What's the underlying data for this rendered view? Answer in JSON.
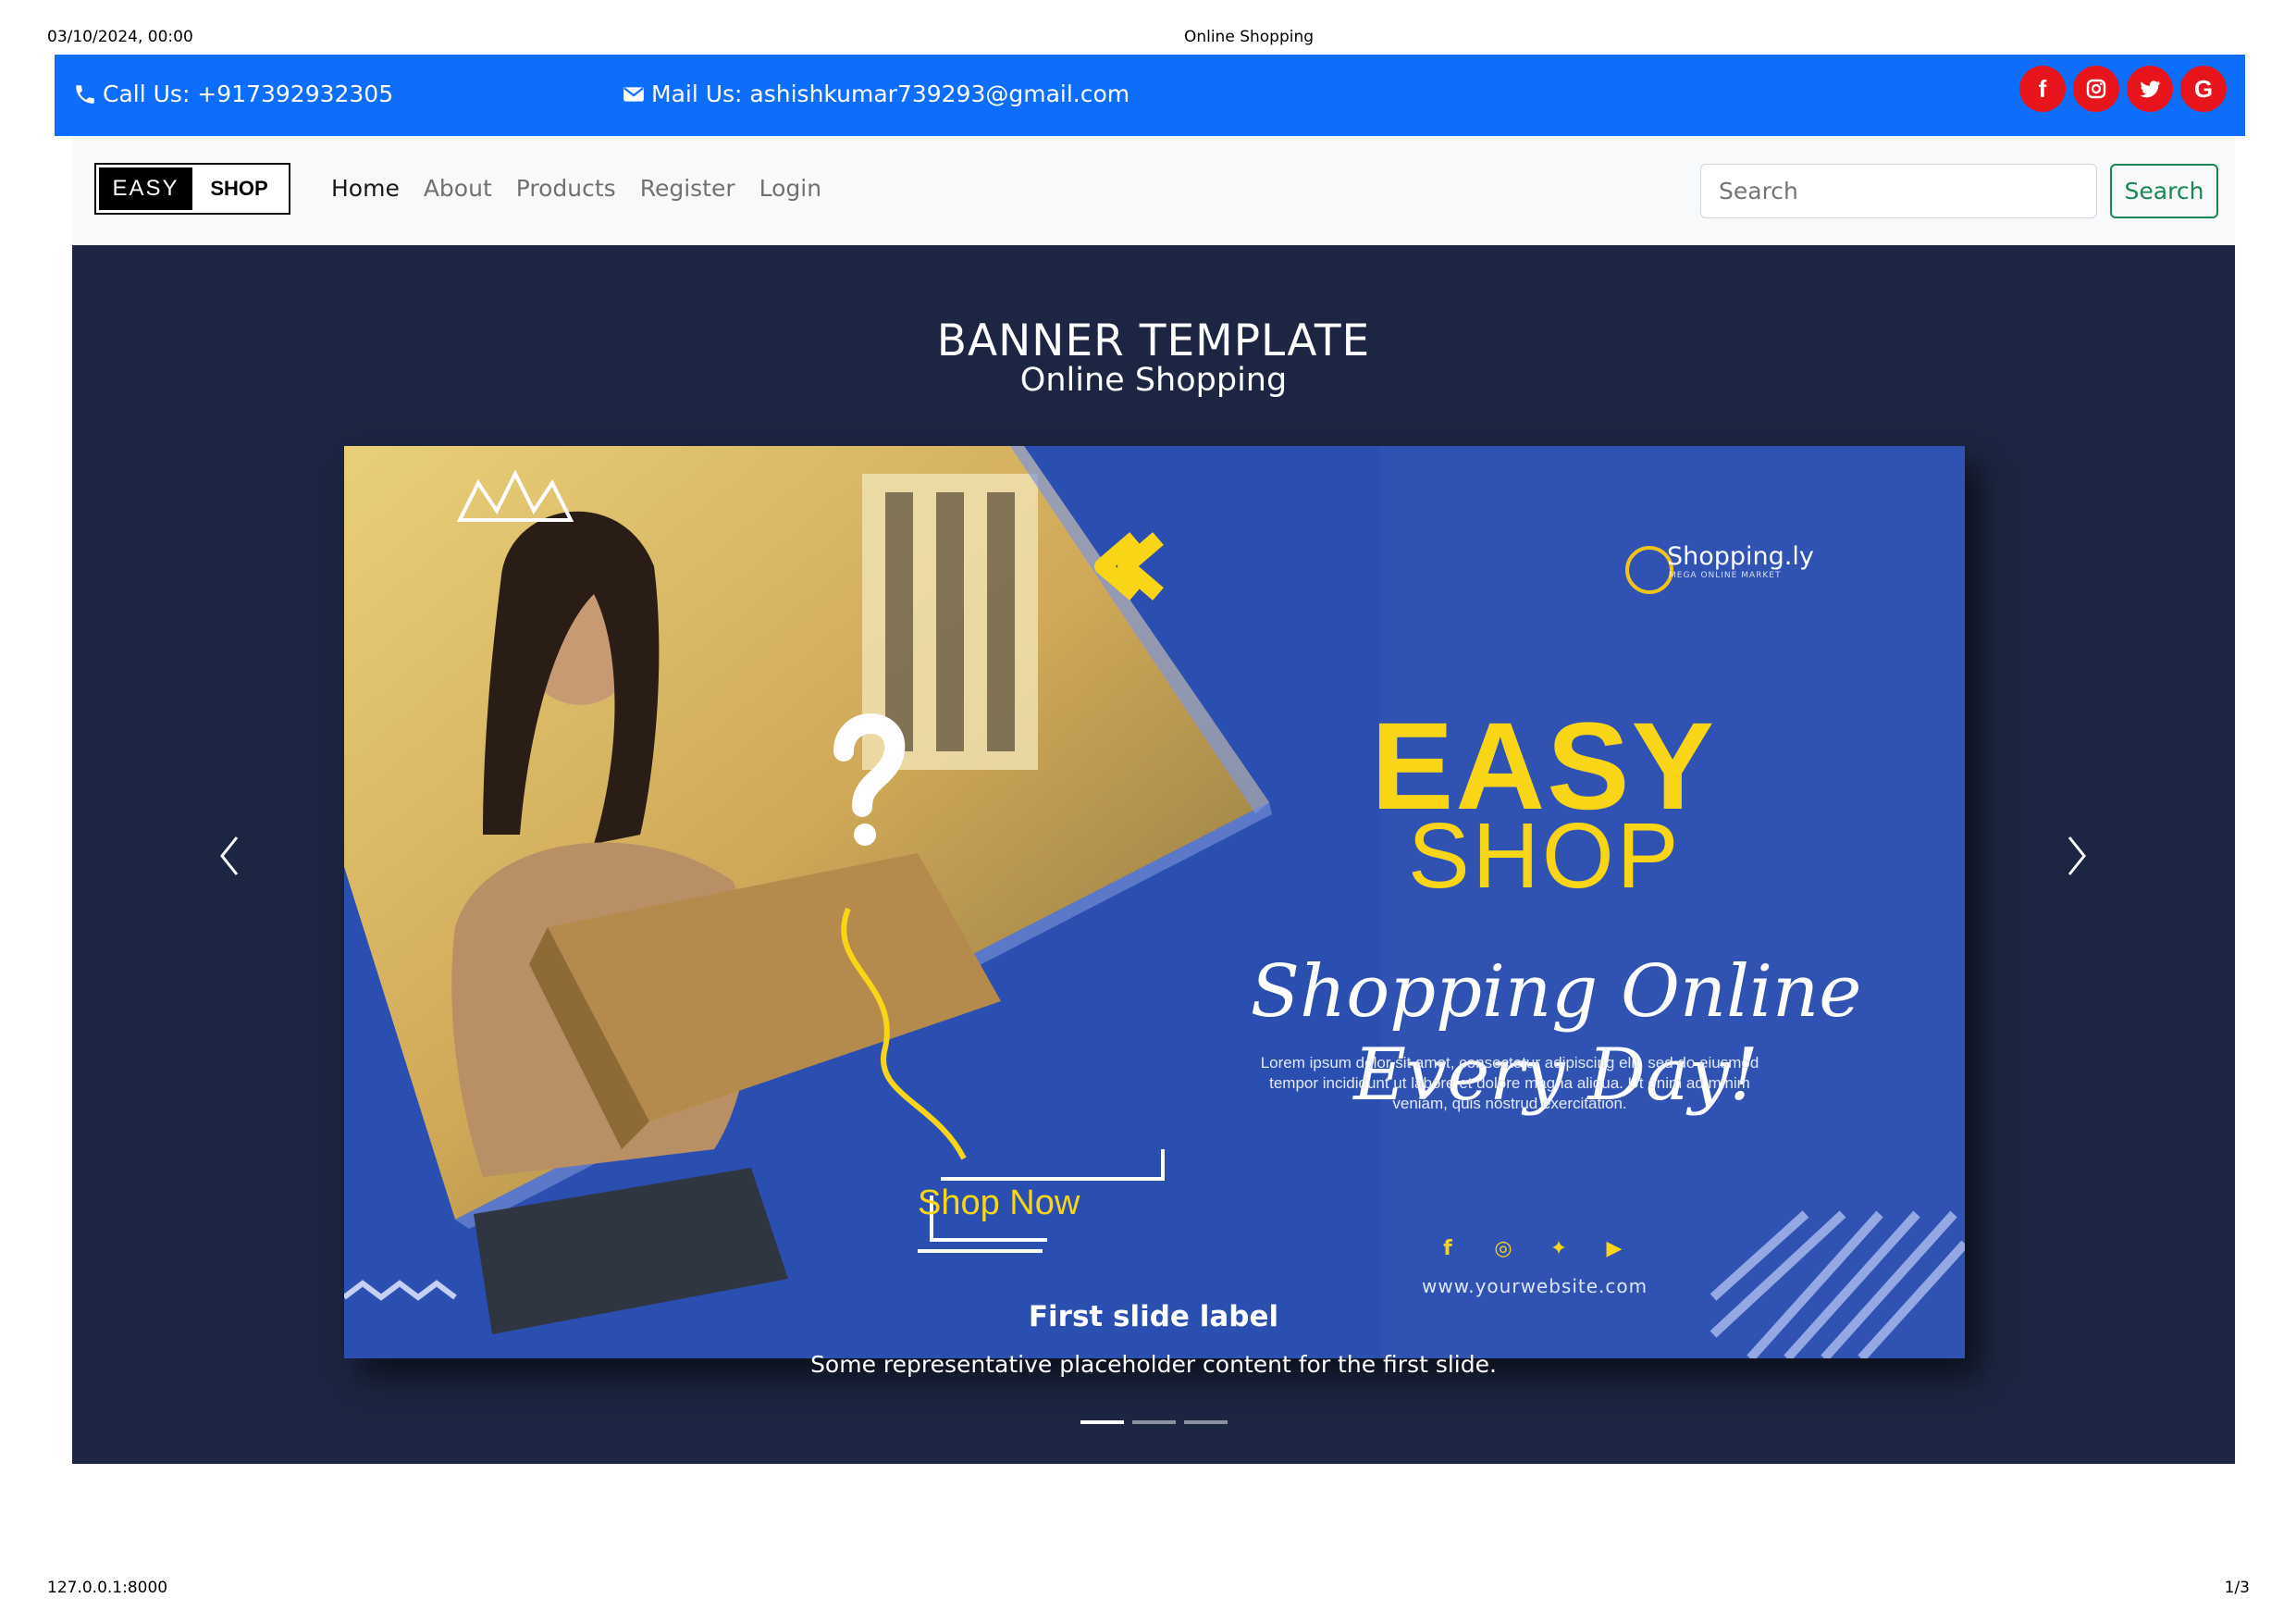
{
  "print": {
    "datetime": "03/10/2024, 00:00",
    "title": "Online Shopping",
    "url": "127.0.0.1:8000",
    "page": "1/3"
  },
  "topbar": {
    "phone": "Call Us: +917392932305",
    "mail": "Mail Us: ashishkumar739293@gmail.com",
    "socials": [
      "facebook-icon",
      "instagram-icon",
      "twitter-icon",
      "google-icon"
    ],
    "bg_color": "#0d6efd",
    "social_color": "#e8141b"
  },
  "navbar": {
    "logo_left": "EASY",
    "logo_right": "SHOP",
    "links": [
      "Home",
      "About",
      "Products",
      "Register",
      "Login"
    ],
    "search_placeholder": "Search",
    "search_button": "Search"
  },
  "carousel": {
    "banner_title": "BANNER TEMPLATE",
    "banner_subtitle": "Online Shopping",
    "card": {
      "brand": "Shopping.ly",
      "brand_sub": "MEGA ONLINE MARKET",
      "headline_1": "EASY",
      "headline_2": "SHOP",
      "tagline": "Shopping Online Every Day!",
      "lorem": "Lorem ipsum dolor sit amet, consectetur adipiscing elit, sed do eiusmod tempor incididunt ut labore et dolore magna aliqua. Ut enim ad minim veniam, quis nostrud exercitation.",
      "cta": "Shop Now",
      "website": "www.yourwebsite.com"
    },
    "caption_title": "First slide label",
    "caption_text": "Some representative placeholder content for the first slide.",
    "slide_count": 3,
    "active_slide": 1,
    "bg_color": "#1c2541",
    "accent_yellow": "#f9d518"
  }
}
